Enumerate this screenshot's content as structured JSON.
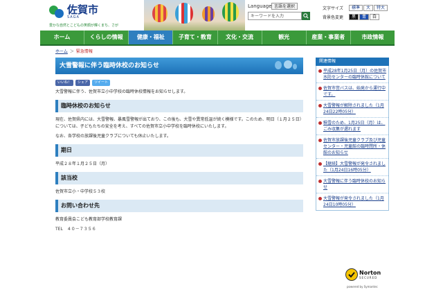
{
  "header": {
    "logo_name": "佐賀市",
    "logo_sub": "SAGA",
    "tagline": "豊かな自然とこどもの笑顔が輝くまち、さが",
    "language_label": "Language",
    "language_select": "言語を選択",
    "search_placeholder": "キーワードを入力",
    "font_size_label": "文字サイズ",
    "font_sizes": [
      "標準",
      "大",
      "特大"
    ],
    "bg_color_label": "背景色変更",
    "bg_colors": [
      "黒",
      "青",
      "白"
    ]
  },
  "nav": {
    "items": [
      "ホーム",
      "くらしの情報",
      "健康・福祉",
      "子育て・教育",
      "文化・交流",
      "観光",
      "産業・事業者",
      "市政情報"
    ]
  },
  "breadcrumb": {
    "home": "ホーム",
    "sep": "＞",
    "current": "緊急情報"
  },
  "main": {
    "title": "大雪警報に伴う臨時休校のお知らせ",
    "social": {
      "like": "いいね！",
      "share": "シェア",
      "tweet": "ツイート"
    },
    "intro": "大雪警報に伴う、佐賀市立小中学校の臨時休校情報をお知らせします。",
    "section1_title": "臨時休校のお知らせ",
    "section1_p1": "現在、佐賀県内には、大雪警報、暴風雪警報が出ており、この後も、大雪や異常低温が続く模様です。このため、明日（１月２５日）については、子どもたちの安全を考え、すべての佐賀市立小中学校を臨時休校にいたします。",
    "section1_p2": "なお、各学校の放課後児童クラブについても休止いたします。",
    "section2_title": "期日",
    "section2_text": "平成２８年１月２５日（月）",
    "section3_title": "該当校",
    "section3_text": "佐賀市立小・中学校５３校",
    "section4_title": "お問い合わせ先",
    "section4_org": "教育委員会こども教育部学校教育課",
    "section4_tel": "TEL　４０－７３５６"
  },
  "sidebar": {
    "heading": "関連情報",
    "items": [
      "平成28年1月25日（月）の佐賀市水防センターの臨時休館について",
      "佐賀市営バスは、始発から運行中です。",
      "大雪警報が解除されました（1月24日22時05分）",
      "積雪のため、1月25日（月）は、ごみ収集が遅れます",
      "佐賀市放課後児童クラブ及び児童センター・児童館の臨時閉所・休館のお知らせ",
      "【継続】大雪警報が発令されました（1月24日16時05分）",
      "大雪警報に伴う臨時休校のお知らせ",
      "大雪警報が発令されました（1月24日10時05分）"
    ]
  },
  "norton": {
    "name": "Norton",
    "secured": "SECURED",
    "powered": "powered by Symantec"
  },
  "colors": {
    "nav_green": "#3b9a3b",
    "nav_active_blue": "#2e7fbf",
    "title_blue": "#1d72b8",
    "section_bg": "#dbe9f4"
  }
}
